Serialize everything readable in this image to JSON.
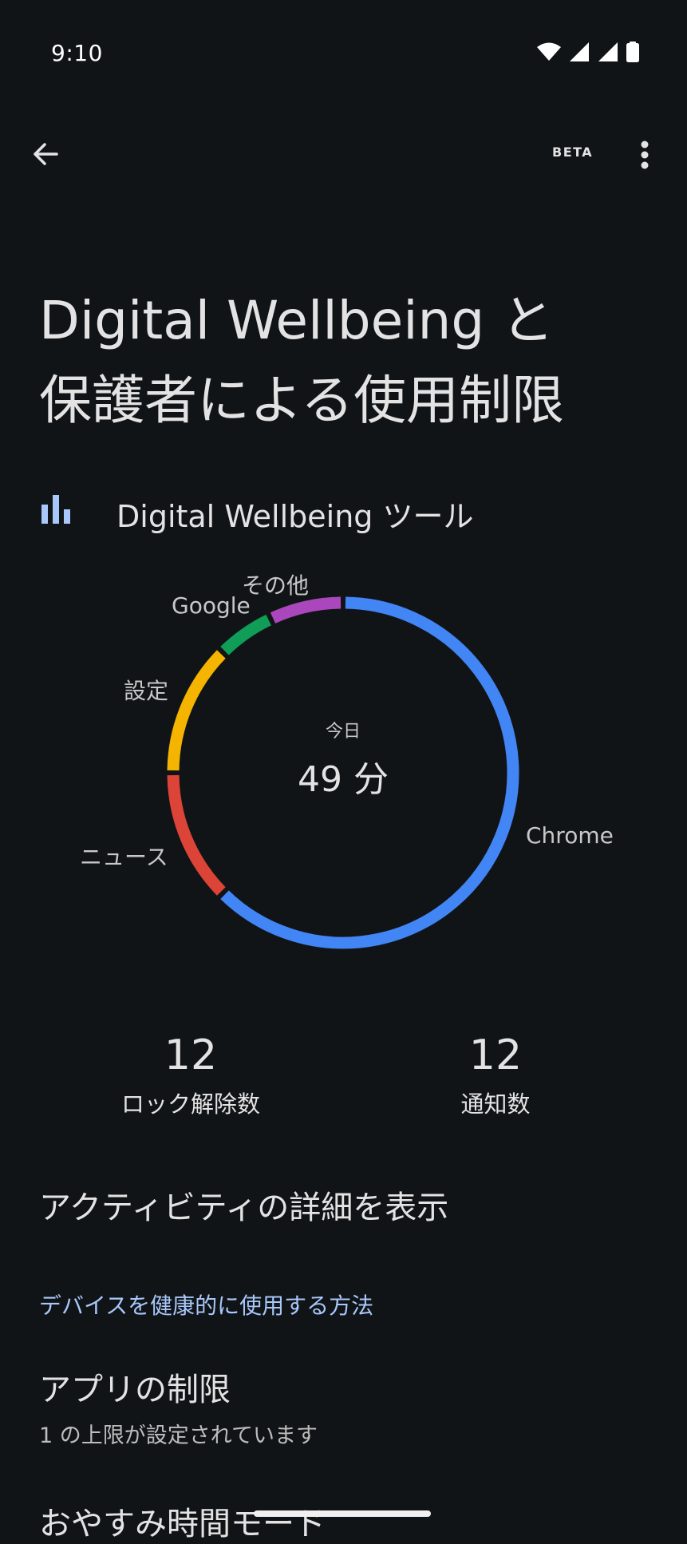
{
  "status_bar": {
    "time": "9:10"
  },
  "app_bar": {
    "beta": "BETA"
  },
  "title": {
    "line1": "Digital Wellbeing と",
    "line2": "保護者による使用制限"
  },
  "tools": {
    "label": "Digital Wellbeing ツール",
    "icon": "bar-chart-icon"
  },
  "usage_chart": {
    "center_caption": "今日",
    "center_value": "49 分",
    "colors": {
      "chrome": "#4285f4",
      "news": "#db4437",
      "settings": "#f4b400",
      "google": "#0f9d58",
      "other": "#ab47bc"
    },
    "segments": [
      {
        "label": "Chrome",
        "fraction": 0.625
      },
      {
        "label": "ニュース",
        "fraction": 0.125
      },
      {
        "label": "設定",
        "fraction": 0.125
      },
      {
        "label": "Google",
        "fraction": 0.055
      },
      {
        "label": "その他",
        "fraction": 0.07
      }
    ]
  },
  "stats": {
    "unlocks": {
      "value": "12",
      "label": "ロック解除数"
    },
    "notifications": {
      "value": "12",
      "label": "通知数"
    }
  },
  "activity_link": "アクティビティの詳細を表示",
  "section_header": "デバイスを健康的に使用する方法",
  "app_limits": {
    "title": "アプリの制限",
    "subtitle": "1 の上限が設定されています"
  },
  "bedtime": {
    "title": "おやすみ時間モード"
  }
}
